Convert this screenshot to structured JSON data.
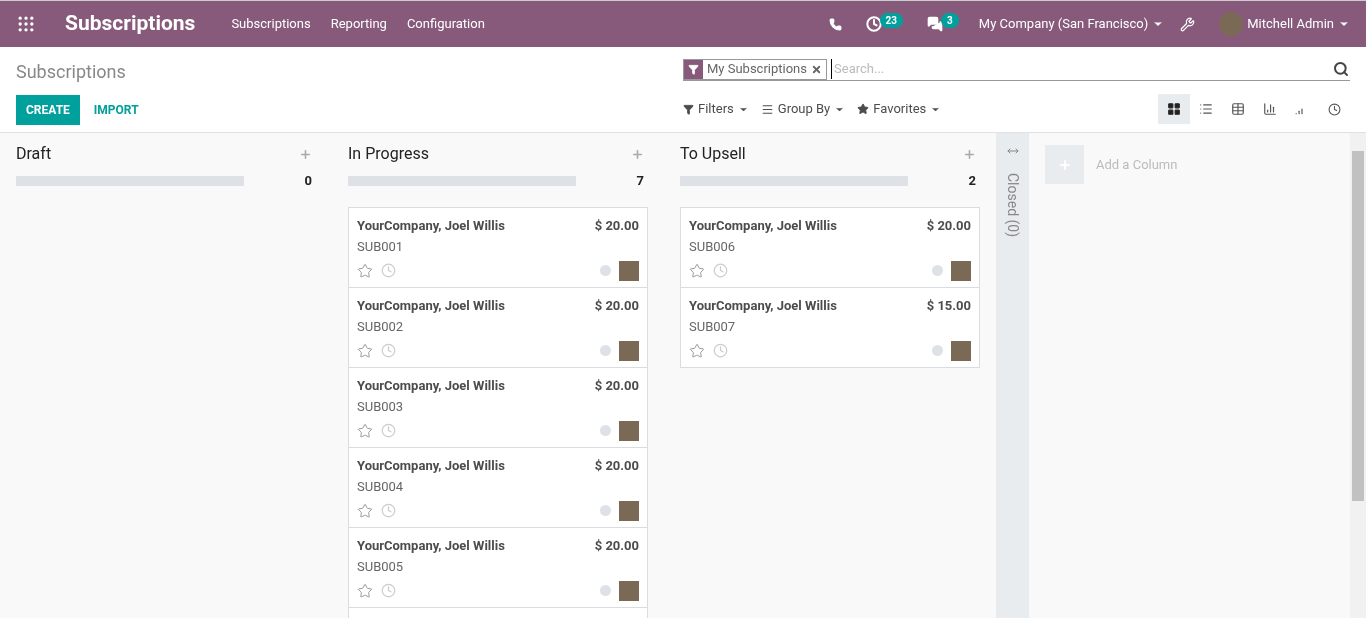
{
  "navbar": {
    "app_title": "Subscriptions",
    "menu": [
      "Subscriptions",
      "Reporting",
      "Configuration"
    ],
    "activity_count": "23",
    "message_count": "3",
    "company": "My Company (San Francisco)",
    "user": "Mitchell Admin"
  },
  "control_panel": {
    "breadcrumb": "Subscriptions",
    "buttons": [
      "CREATE",
      "IMPORT"
    ],
    "facet": "My Subscriptions",
    "search": {
      "placeholder": "Search..."
    },
    "search_menus": [
      "Filters",
      "Group By",
      "Favorites"
    ],
    "views": [
      {
        "kind": "kanban",
        "selected": true
      },
      {
        "kind": "list",
        "selected": false
      },
      {
        "kind": "pivot",
        "selected": false
      },
      {
        "kind": "graph",
        "selected": false
      },
      {
        "kind": "cohort",
        "selected": false
      },
      {
        "kind": "activity",
        "selected": false
      }
    ]
  },
  "columns": [
    {
      "title": "Draft",
      "count": "0",
      "level": 0
    },
    {
      "title": "In Progress",
      "count": "7",
      "level": 0,
      "more_below": true,
      "cards": [
        {
          "customer": "YourCompany, Joel Willis",
          "amount": "$ 20.00",
          "reference": "SUB001",
          "starred": false
        },
        {
          "customer": "YourCompany, Joel Willis",
          "amount": "$ 20.00",
          "reference": "SUB002",
          "starred": false
        },
        {
          "customer": "YourCompany, Joel Willis",
          "amount": "$ 20.00",
          "reference": "SUB003",
          "starred": false
        },
        {
          "customer": "YourCompany, Joel Willis",
          "amount": "$ 20.00",
          "reference": "SUB004",
          "starred": false
        },
        {
          "customer": "YourCompany, Joel Willis",
          "amount": "$ 20.00",
          "reference": "SUB005",
          "starred": false
        }
      ]
    },
    {
      "title": "To Upsell",
      "count": "2",
      "level": 0,
      "cards": [
        {
          "customer": "YourCompany, Joel Willis",
          "amount": "$ 20.00",
          "reference": "SUB006",
          "starred": false
        },
        {
          "customer": "YourCompany, Joel Willis",
          "amount": "$ 15.00",
          "reference": "SUB007",
          "starred": false
        }
      ]
    }
  ],
  "folded_column": "Closed (0)",
  "add_column": "Add a Column"
}
